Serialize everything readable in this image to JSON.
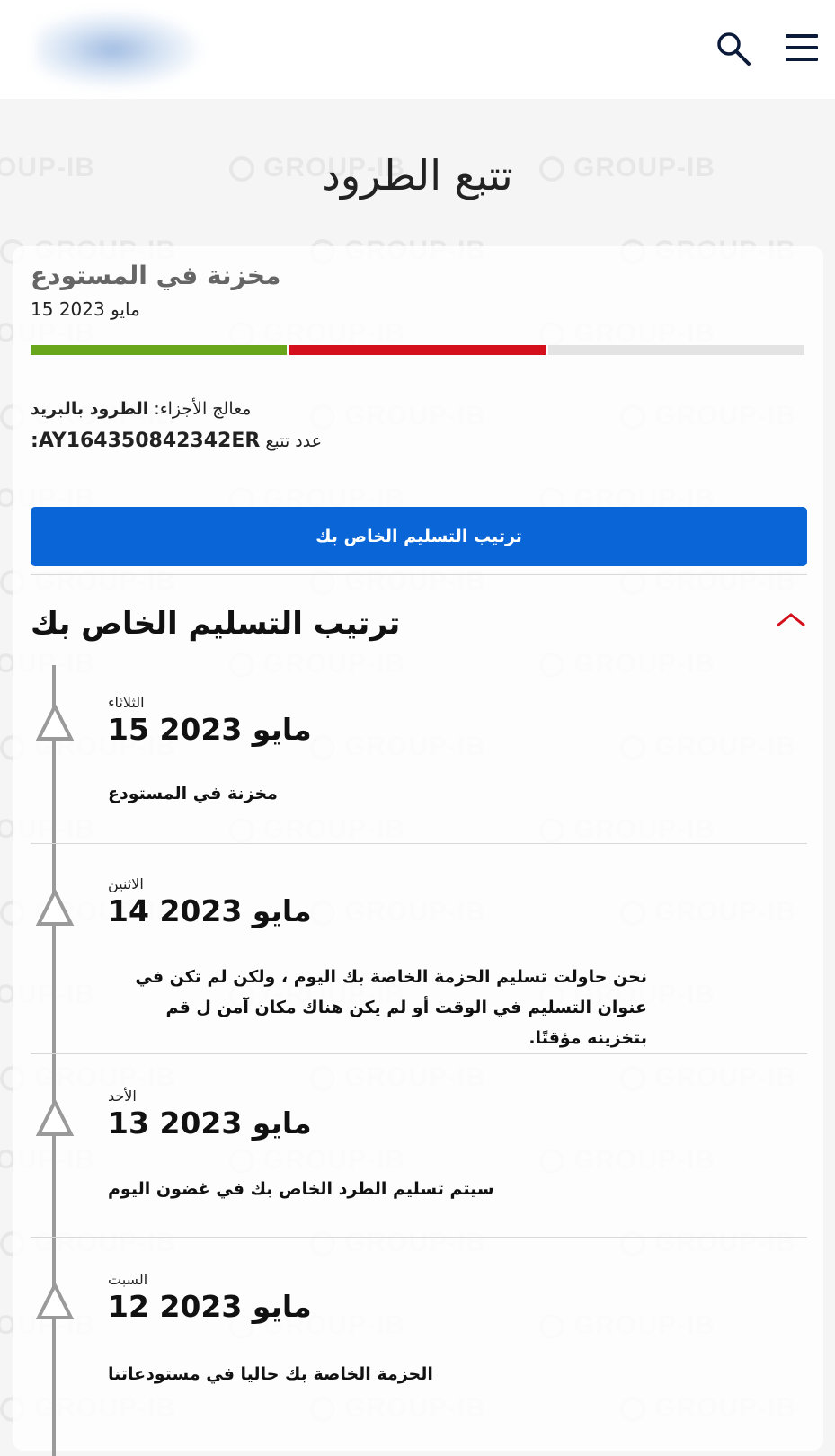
{
  "watermark": "GROUP-IB",
  "header": {
    "logo": "blurred-logo",
    "icons": [
      "search-icon",
      "menu-icon"
    ]
  },
  "page_title": "تتبع الطرود",
  "status": {
    "title": "مخزنة في المستودع",
    "date": "مايو 2023 15",
    "progress_colors": [
      "#6aa61c",
      "#d3101b",
      "#e3e3e3"
    ]
  },
  "details": {
    "handler_label": "معالج الأجزاء:",
    "handler_value": "الطرود بالبريد",
    "tracking_label": "عدد تتبع",
    "tracking_value": "AY164350842342ER:"
  },
  "arrange_button": "ترتيب التسليم الخاص بك",
  "section_title": "ترتيب التسليم الخاص بك",
  "accent": "#0a66d6",
  "events": [
    {
      "day": "الثلاثاء",
      "date": "مايو 2023 15",
      "desc": "مخزنة في المستودع"
    },
    {
      "day": "الاثنين",
      "date": "مايو 2023 14",
      "desc": "نحن حاولت تسليم الحزمة الخاصة بك اليوم ، ولكن لم تكن في عنوان التسليم في الوقت أو لم يكن هناك مكان آمن ل قم بتخزينه مؤقتًا."
    },
    {
      "day": "الأحد",
      "date": "مايو 2023 13",
      "desc": "سيتم تسليم الطرد الخاص بك في غضون اليوم"
    },
    {
      "day": "السبت",
      "date": "مايو 2023 12",
      "desc": "الحزمة الخاصة بك حاليا في مستودعاتنا"
    }
  ]
}
